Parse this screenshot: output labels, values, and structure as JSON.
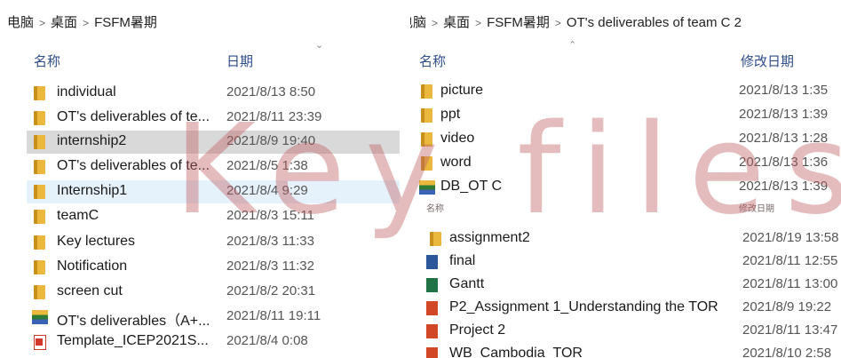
{
  "left": {
    "breadcrumb": [
      "电脑",
      "桌面",
      "FSFM暑期"
    ],
    "header": {
      "name": "名称",
      "date": "日期"
    },
    "rows": [
      {
        "name": "individual",
        "date": "2021/8/13 8:50",
        "icon": "folder-icon"
      },
      {
        "name": "OT's deliverables of te...",
        "date": "2021/8/11 23:39",
        "icon": "folder-icon"
      },
      {
        "name": "internship2",
        "date": "2021/8/9 19:40",
        "icon": "folder-icon"
      },
      {
        "name": "OT's deliverables of te...",
        "date": "2021/8/5 1:38",
        "icon": "folder-icon"
      },
      {
        "name": "Internship1",
        "date": "2021/8/4 9:29",
        "icon": "folder-icon"
      },
      {
        "name": "teamC",
        "date": "2021/8/3 15:11",
        "icon": "folder-icon"
      },
      {
        "name": "Key lectures",
        "date": "2021/8/3 11:33",
        "icon": "folder-icon"
      },
      {
        "name": "Notification",
        "date": "2021/8/3 11:32",
        "icon": "folder-icon"
      },
      {
        "name": "screen cut",
        "date": "2021/8/2 20:31",
        "icon": "folder-icon"
      },
      {
        "name": "OT's deliverables（A+...",
        "date": "2021/8/11 19:11",
        "icon": "archive-icon"
      },
      {
        "name": "Template_ICEP2021S...",
        "date": "2021/8/4 0:08",
        "icon": "pdf-icon"
      }
    ]
  },
  "right": {
    "breadcrumb": [
      "电脑",
      "桌面",
      "FSFM暑期",
      "OT's deliverables of team C 2"
    ],
    "header": {
      "name": "名称",
      "date": "修改日期"
    },
    "rows_top": [
      {
        "name": "picture",
        "date": "2021/8/13 1:35",
        "icon": "folder-icon"
      },
      {
        "name": "ppt",
        "date": "2021/8/13 1:39",
        "icon": "folder-icon"
      },
      {
        "name": "video",
        "date": "2021/8/13 1:28",
        "icon": "folder-icon"
      },
      {
        "name": "word",
        "date": "2021/8/13 1:36",
        "icon": "folder-icon"
      },
      {
        "name": "DB_OT C",
        "date": "2021/8/13 1:39",
        "icon": "archive-icon"
      }
    ],
    "ghost_header": {
      "name": "名称",
      "date": "修改日期"
    },
    "rows_bottom": [
      {
        "name": "assignment2",
        "date": "2021/8/19 13:58",
        "icon": "folder-icon"
      },
      {
        "name": "final",
        "date": "2021/8/11 12:55",
        "icon": "word-icon"
      },
      {
        "name": "Gantt",
        "date": "2021/8/11 13:00",
        "icon": "excel-icon"
      },
      {
        "name": "P2_Assignment 1_Understanding the TOR",
        "date": "2021/8/9 19:22",
        "icon": "ppt-icon"
      },
      {
        "name": "Project 2",
        "date": "2021/8/11 13:47",
        "icon": "ppt-icon"
      },
      {
        "name": "WB_Cambodia_TOR",
        "date": "2021/8/10 2:58",
        "icon": "ppt-icon"
      }
    ]
  },
  "watermark": "Key files",
  "colors": {
    "header_text": "#2e4d8a",
    "watermark": "#be5f64",
    "selection_gray": "#d9d9d9",
    "selection_blue": "#e5f1fb"
  }
}
